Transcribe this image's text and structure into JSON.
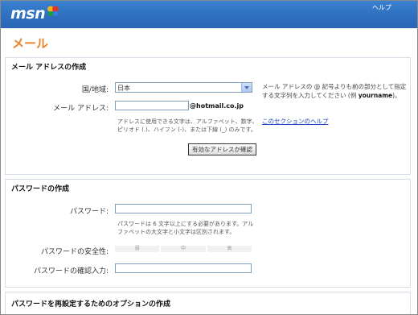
{
  "header": {
    "logo": "msn",
    "help": "ヘルプ"
  },
  "page_title": "メール",
  "email_section": {
    "heading": "メール アドレスの作成",
    "country_label": "国/地域:",
    "country_value": "日本",
    "email_label": "メール アドレス:",
    "email_value": "",
    "domain_suffix": "@hotmail.co.jp",
    "chars_note": "アドレスに使用できる文字は、アルファベット、数字、ピリオド (.)、ハイフン (-)、または下線 (_) のみです。",
    "check_button": "有効なアドレスか確認",
    "side_note_pre": "メール アドレスの @ 記号よりも前の部分として指定する文字列を入力してください (例 ",
    "side_note_example": "yourname",
    "side_note_post": ")。",
    "help_link": "このセクションのヘルプ"
  },
  "password_section": {
    "heading": "パスワードの作成",
    "password_label": "パスワード:",
    "password_note": "パスワードは 6 文字以上にする必要があります。アルファベットの大文字と小文字は区別されます。",
    "strength_label": "パスワードの安全性:",
    "strength_levels": [
      "弱",
      "中",
      "高"
    ],
    "confirm_label": "パスワードの確認入力:"
  },
  "reset_section": {
    "heading": "パスワードを再設定するためのオプションの作成"
  },
  "colors": {
    "header_blue": "#2f6fc0",
    "title_orange": "#e9822a",
    "link_blue": "#1a44c0"
  }
}
